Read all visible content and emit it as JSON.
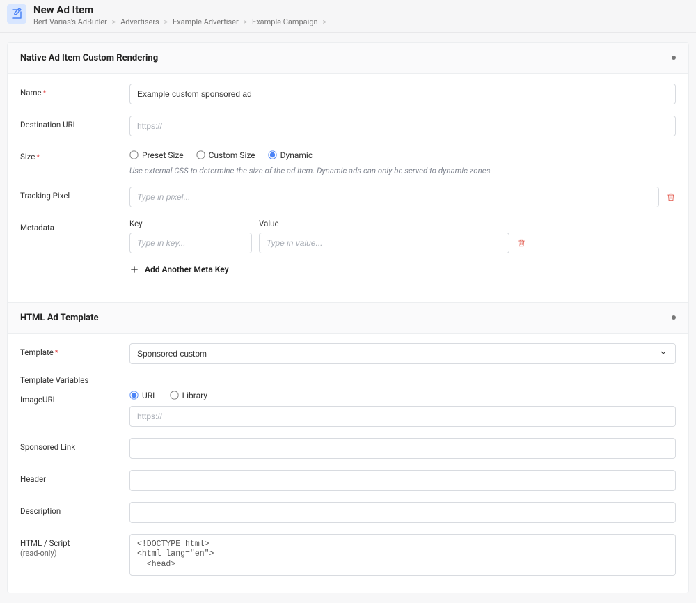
{
  "header": {
    "title": "New Ad Item",
    "breadcrumbs": [
      "Bert Varias's AdButler",
      "Advertisers",
      "Example Advertiser",
      "Example Campaign"
    ]
  },
  "sections": {
    "rendering": {
      "title": "Native Ad Item Custom Rendering",
      "fields": {
        "name_label": "Name",
        "name_value": "Example custom sponsored ad",
        "dest_label": "Destination URL",
        "dest_placeholder": "https://",
        "size_label": "Size",
        "size_options": {
          "preset": "Preset Size",
          "custom": "Custom Size",
          "dynamic": "Dynamic"
        },
        "size_selected": "dynamic",
        "size_help": "Use external CSS to determine the size of the ad item. Dynamic ads can only be served to dynamic zones.",
        "tracking_label": "Tracking Pixel",
        "tracking_placeholder": "Type in pixel...",
        "meta_label": "Metadata",
        "key_label": "Key",
        "value_label": "Value",
        "key_placeholder": "Type in key...",
        "value_placeholder": "Type in value...",
        "add_meta": "Add Another Meta Key"
      }
    },
    "template": {
      "title": "HTML Ad Template",
      "fields": {
        "template_label": "Template",
        "template_value": "Sponsored custom",
        "vars_label": "Template Variables",
        "imageurl_label": "ImageURL",
        "imageurl_options": {
          "url": "URL",
          "library": "Library"
        },
        "imageurl_selected": "url",
        "imageurl_placeholder": "https://",
        "sponsored_label": "Sponsored Link",
        "header_label": "Header",
        "description_label": "Description",
        "html_label": "HTML / Script",
        "html_sub": "(read-only)",
        "html_code": "<!DOCTYPE html>\n<html lang=\"en\">\n  <head>"
      }
    }
  }
}
